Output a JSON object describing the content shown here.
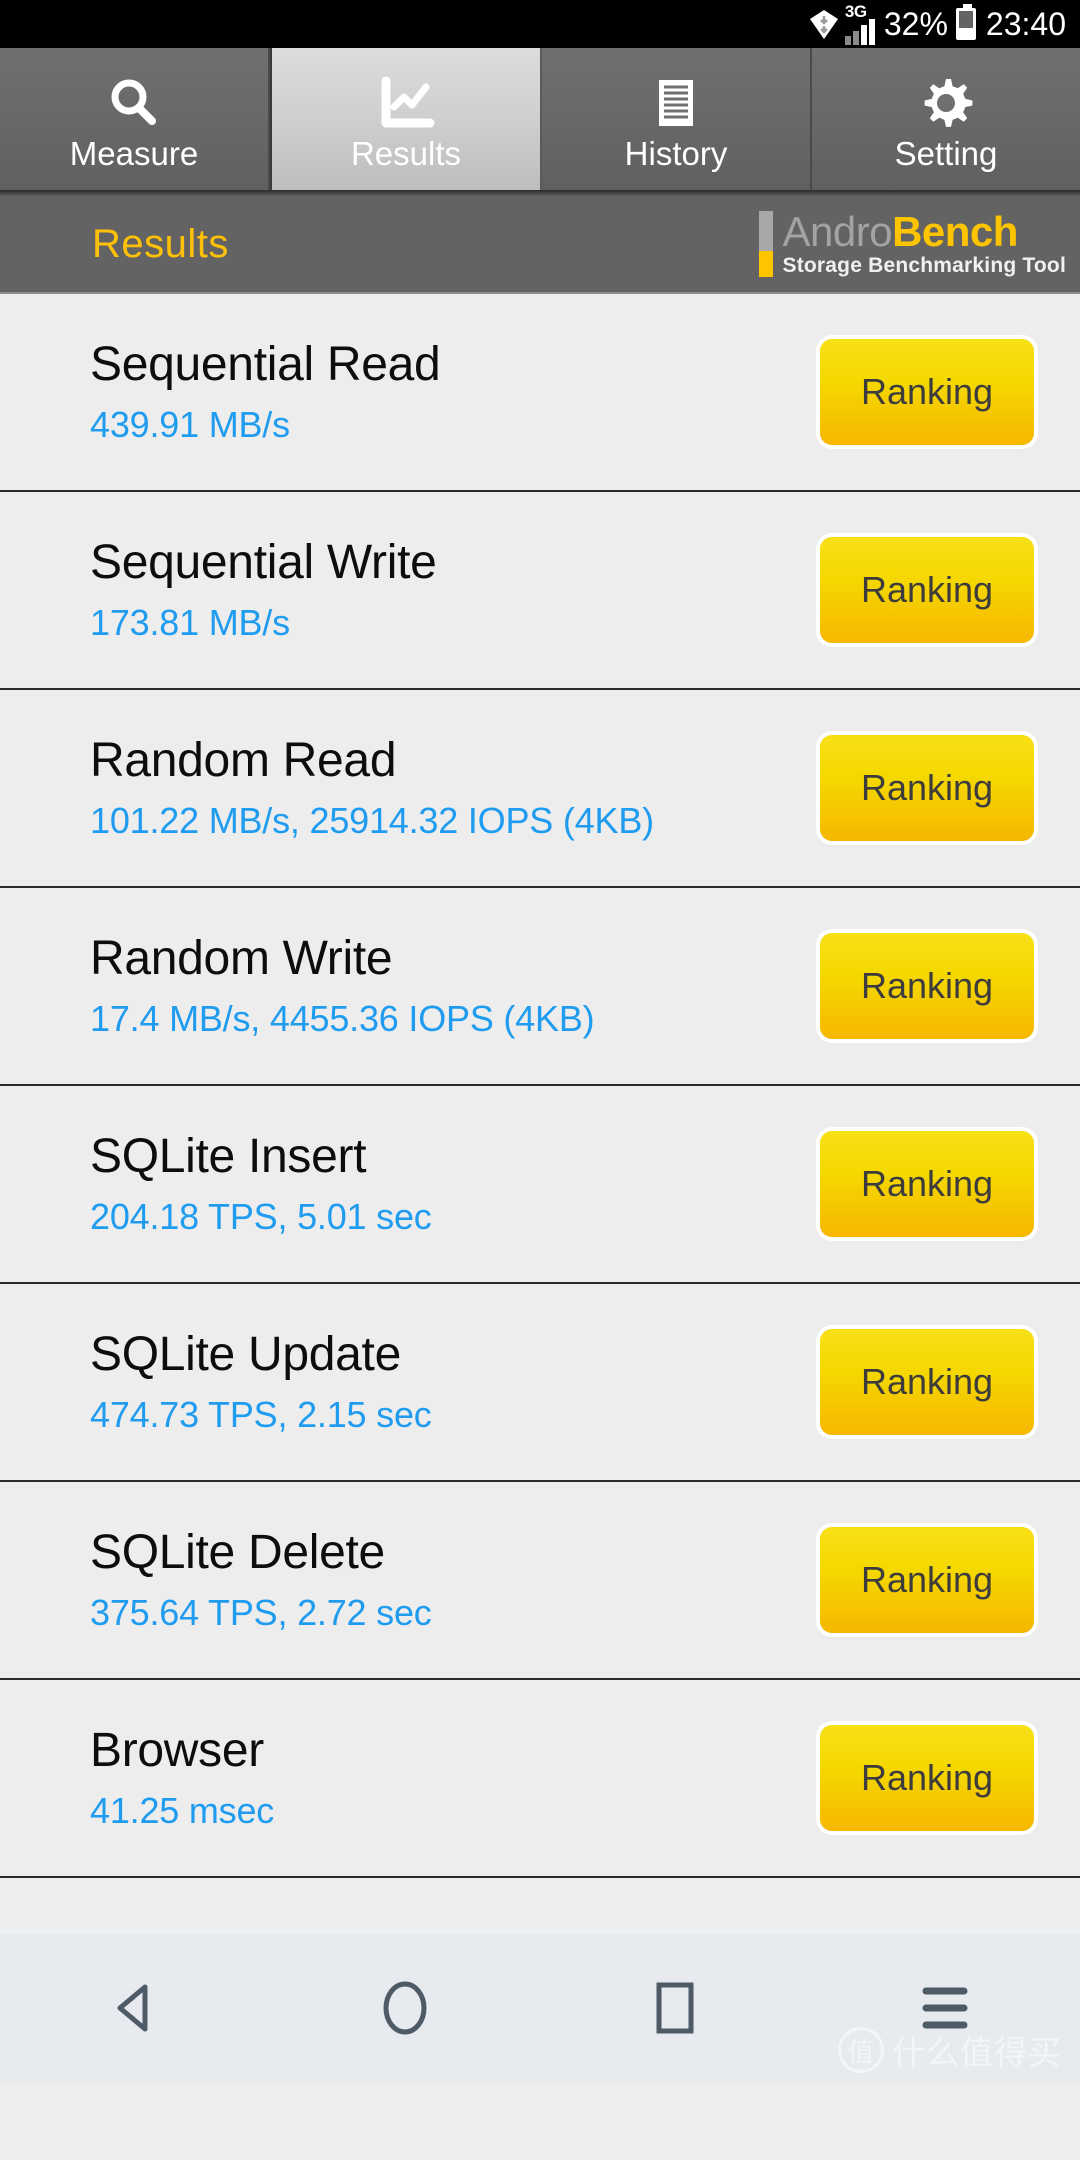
{
  "statusbar": {
    "network_label": "3G",
    "battery_percent": "32%",
    "time": "23:40",
    "icons": [
      "wifi-icon",
      "signal-bars-icon",
      "battery-icon"
    ]
  },
  "tabs": [
    {
      "label": "Measure",
      "icon": "search-icon",
      "selected": false
    },
    {
      "label": "Results",
      "icon": "chart-icon",
      "selected": true
    },
    {
      "label": "History",
      "icon": "document-icon",
      "selected": false
    },
    {
      "label": "Setting",
      "icon": "gear-icon",
      "selected": false
    }
  ],
  "header": {
    "title": "Results",
    "logo_primary": "Andro",
    "logo_accent": "Bench",
    "logo_tagline": "Storage Benchmarking Tool"
  },
  "results": [
    {
      "name": "Sequential Read",
      "value": "439.91 MB/s",
      "action": "Ranking"
    },
    {
      "name": "Sequential Write",
      "value": "173.81 MB/s",
      "action": "Ranking"
    },
    {
      "name": "Random Read",
      "value": "101.22 MB/s, 25914.32 IOPS (4KB)",
      "action": "Ranking"
    },
    {
      "name": "Random Write",
      "value": "17.4 MB/s, 4455.36 IOPS (4KB)",
      "action": "Ranking"
    },
    {
      "name": "SQLite Insert",
      "value": "204.18 TPS, 5.01 sec",
      "action": "Ranking"
    },
    {
      "name": "SQLite Update",
      "value": "474.73 TPS, 2.15 sec",
      "action": "Ranking"
    },
    {
      "name": "SQLite Delete",
      "value": "375.64 TPS, 2.72 sec",
      "action": "Ranking"
    },
    {
      "name": "Browser",
      "value": "41.25 msec",
      "action": "Ranking"
    }
  ],
  "navbar": {
    "buttons": [
      "back-icon",
      "home-icon",
      "recents-icon",
      "menu-icon"
    ]
  },
  "watermark": {
    "badge": "值",
    "text": "什么值得买"
  },
  "colors": {
    "accent_yellow": "#ffc107",
    "value_blue": "#1f9cf0",
    "button_yellow": "#f5d800",
    "header_gray": "#636363",
    "list_bg": "#ededed"
  }
}
